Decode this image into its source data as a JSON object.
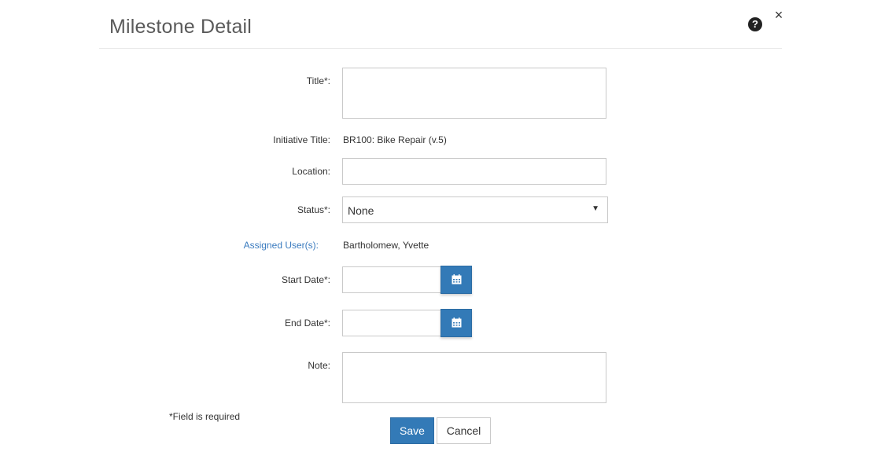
{
  "dialog": {
    "title": "Milestone Detail",
    "help_icon": "question-circle-icon",
    "close_icon": "close-icon",
    "close_glyph": "×",
    "help_glyph": "?"
  },
  "form": {
    "title_label": "Title*:",
    "title_value": "",
    "initiative_label": "Initiative Title:",
    "initiative_value": "BR100: Bike Repair (v.5)",
    "location_label": "Location:",
    "location_value": "",
    "status_label": "Status*:",
    "status_value": "None",
    "assigned_label": "Assigned User(s):",
    "assigned_value": "Bartholomew, Yvette",
    "start_label": "Start Date*:",
    "start_value": "",
    "end_label": "End Date*:",
    "end_value": "",
    "calendar_icon": "calendar-icon",
    "note_label": "Note:",
    "note_value": ""
  },
  "footer": {
    "required_note": "*Field is required",
    "save_label": "Save",
    "cancel_label": "Cancel"
  },
  "colors": {
    "primary": "#337ab7",
    "link": "#3a7bbf",
    "border": "#c9c9c9"
  }
}
